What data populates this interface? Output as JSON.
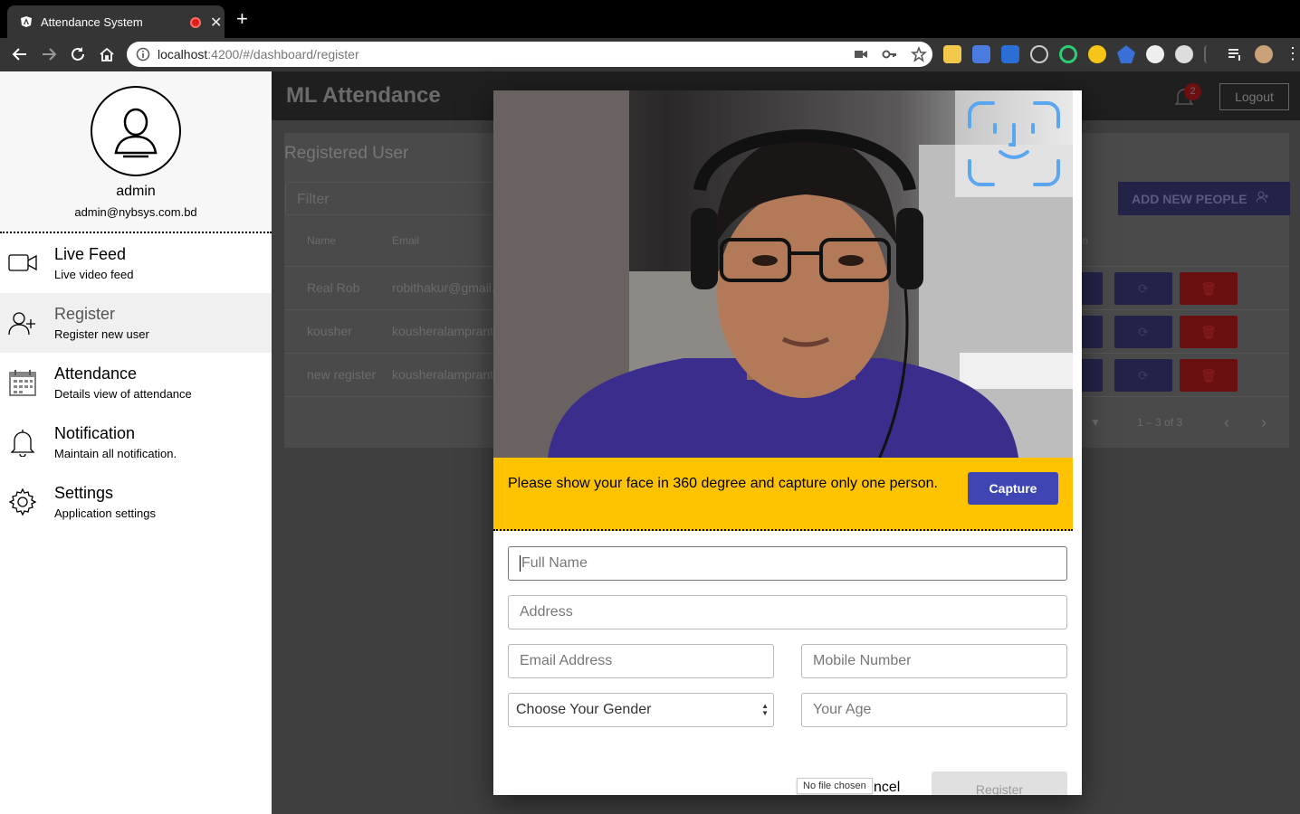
{
  "browser": {
    "tab_title": "Attendance System",
    "url_host": "localhost",
    "url_rest": ":4200/#/dashboard/register",
    "new_tab": "+"
  },
  "sidebar": {
    "user_name": "admin",
    "user_email": "admin@nybsys.com.bd",
    "items": [
      {
        "title": "Live Feed",
        "subtitle": "Live video feed",
        "icon": "video-camera-icon"
      },
      {
        "title": "Register",
        "subtitle": "Register new user",
        "icon": "add-user-icon"
      },
      {
        "title": "Attendance",
        "subtitle": "Details view of attendance",
        "icon": "calendar-icon"
      },
      {
        "title": "Notification",
        "subtitle": "Maintain all notification.",
        "icon": "bell-icon"
      },
      {
        "title": "Settings",
        "subtitle": "Application settings",
        "icon": "gear-icon"
      }
    ]
  },
  "appbar": {
    "title": "ML Attendance",
    "notification_count": "2",
    "logout_label": "Logout"
  },
  "registered": {
    "title": "Registered User",
    "filter_placeholder": "Filter",
    "add_button": "ADD NEW PEOPLE",
    "columns": [
      "Name",
      "Email",
      "ion"
    ],
    "rows": [
      {
        "name": "Real Rob",
        "email": "robithakur@gmail."
      },
      {
        "name": "kousher",
        "email": "kousheralamprant"
      },
      {
        "name": "new register",
        "email": "kousheralamprant"
      }
    ],
    "range": "1 – 3 of 3"
  },
  "dialog": {
    "instruction": "Please show your face in 360 degree and capture only one person.",
    "capture_label": "Capture",
    "full_name_placeholder": "Full Name",
    "address_placeholder": "Address",
    "email_placeholder": "Email Address",
    "mobile_placeholder": "Mobile Number",
    "gender_selected": "Choose Your Gender",
    "age_placeholder": "Your Age",
    "file_tooltip": "No file chosen",
    "cancel_label": "ncel",
    "register_label": "Register"
  },
  "colors": {
    "banner": "#fdc300",
    "capture_button": "#3f45b3",
    "delete_button": "#6b1010"
  }
}
